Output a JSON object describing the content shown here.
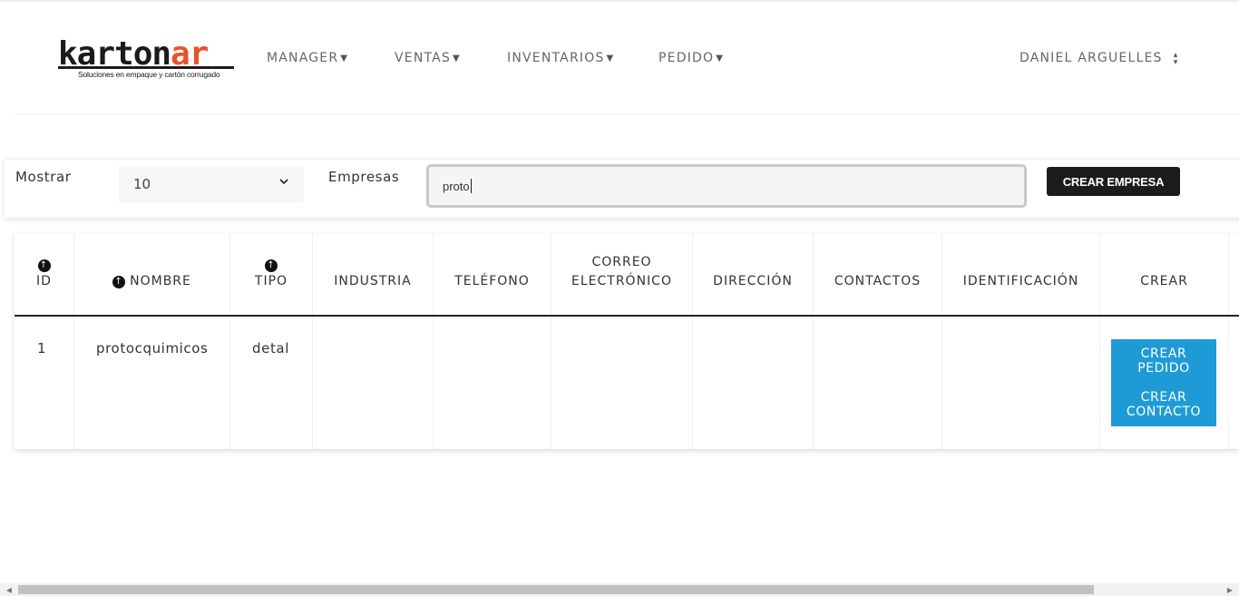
{
  "brand": {
    "logo_part1": "karton",
    "logo_part2": "ar",
    "tagline": "Soluciones en empaque y cartón corrugado",
    "accent": "#e8542a"
  },
  "nav": {
    "items": [
      {
        "label": "MANAGER"
      },
      {
        "label": "VENTAS"
      },
      {
        "label": "INVENTARIOS"
      },
      {
        "label": "PEDIDO"
      }
    ]
  },
  "user": {
    "name": "DANIEL ARGUELLES"
  },
  "filters": {
    "show_label": "Mostrar",
    "show_value": "10",
    "search_label": "Empresas",
    "search_value": "proto",
    "create_button": "CREAR EMPRESA"
  },
  "table": {
    "headers": {
      "id": "ID",
      "nombre": "NOMBRE",
      "tipo": "TIPO",
      "industria": "INDUSTRIA",
      "telefono": "TELÉFONO",
      "correo_1": "CORREO",
      "correo_2": "ELECTRÓNICO",
      "direccion": "DIRECCIÓN",
      "contactos": "CONTACTOS",
      "identificacion": "IDENTIFICACIÓN",
      "crear": "CREAR"
    },
    "rows": [
      {
        "id": "1",
        "nombre": "protocquimicos",
        "tipo": "detal",
        "crear_pedido_1": "CREAR",
        "crear_pedido_2": "PEDIDO",
        "crear_contacto_1": "CREAR",
        "crear_contacto_2": "CONTACTO"
      }
    ]
  },
  "colors": {
    "primary_button": "#1e9bd7",
    "dark_button": "#1c1c1c"
  }
}
